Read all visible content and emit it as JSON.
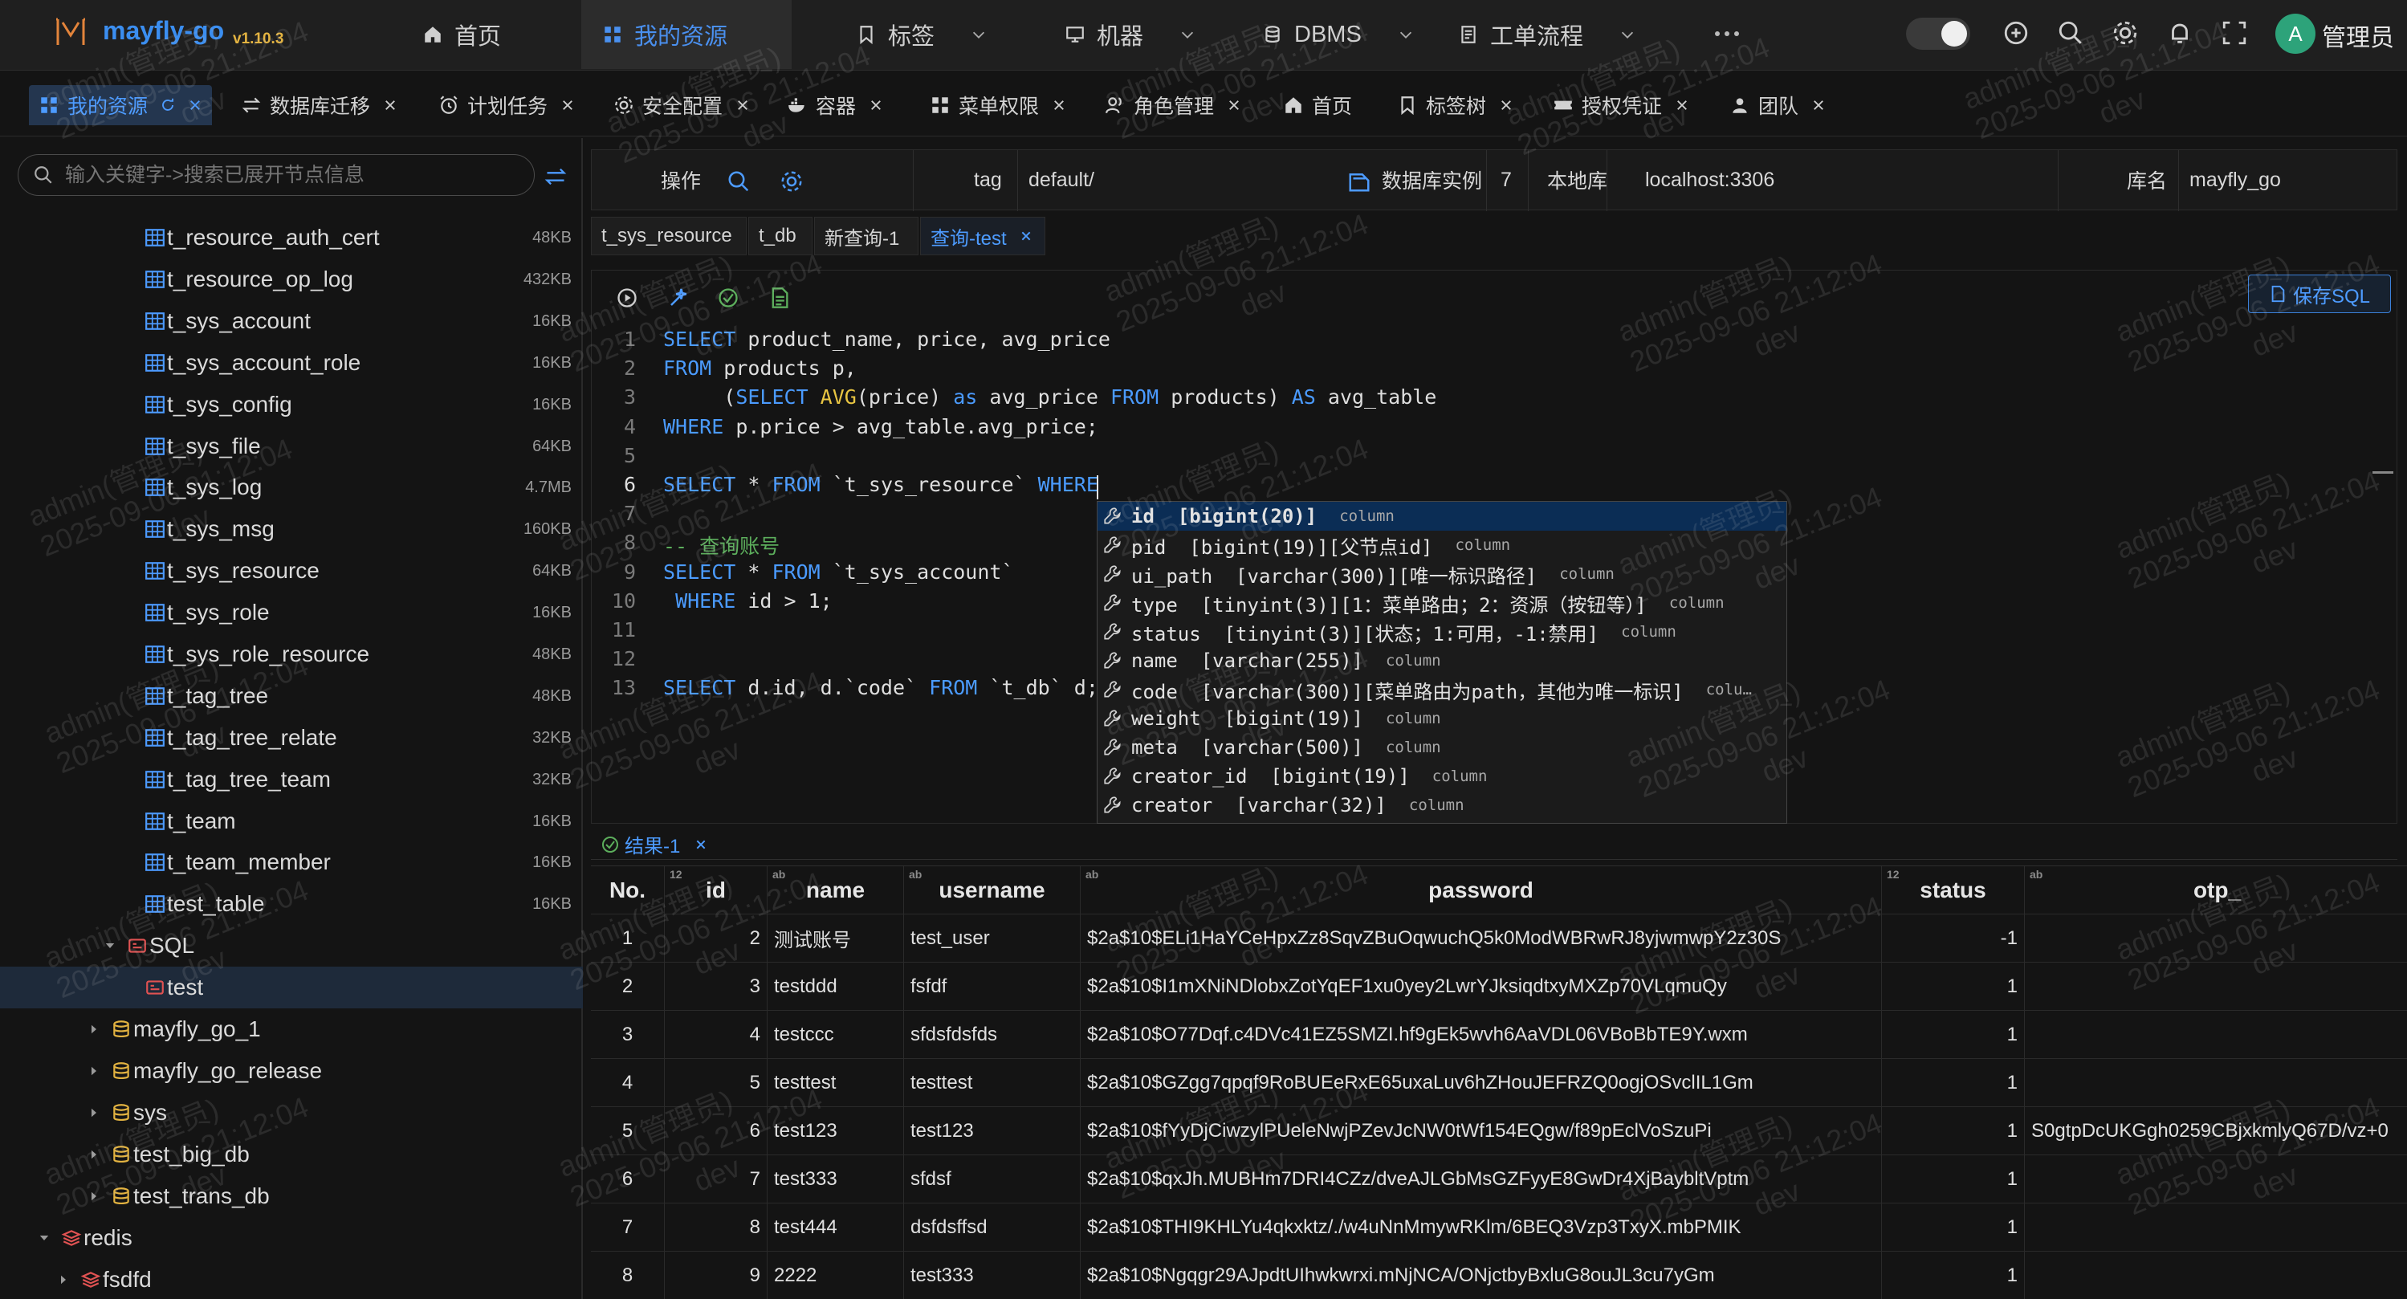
{
  "app": {
    "name": "mayfly-go",
    "version": "v1.10.3"
  },
  "nav": [
    {
      "label": "首页",
      "icon": "home-icon"
    },
    {
      "label": "我的资源",
      "icon": "grid-icon",
      "active": true
    },
    {
      "label": "标签",
      "icon": "bookmark-icon"
    },
    {
      "label": "机器",
      "icon": "monitor-icon"
    },
    {
      "label": "DBMS",
      "icon": "database-icon"
    },
    {
      "label": "工单流程",
      "icon": "workflow-icon"
    }
  ],
  "user": {
    "avatar_letter": "A",
    "name": "管理员"
  },
  "tabs": [
    {
      "label": "我的资源",
      "icon": "grid-icon",
      "active": true
    },
    {
      "label": "数据库迁移",
      "icon": "transfer-icon"
    },
    {
      "label": "计划任务",
      "icon": "alarm-icon"
    },
    {
      "label": "安全配置",
      "icon": "gear-icon"
    },
    {
      "label": "容器",
      "icon": "docker-icon"
    },
    {
      "label": "菜单权限",
      "icon": "grid-icon"
    },
    {
      "label": "角色管理",
      "icon": "users-icon"
    },
    {
      "label": "首页",
      "icon": "home-icon",
      "closable": false
    },
    {
      "label": "标签树",
      "icon": "bookmark-icon"
    },
    {
      "label": "授权凭证",
      "icon": "ticket-icon"
    },
    {
      "label": "团队",
      "icon": "user-icon"
    }
  ],
  "sidebar": {
    "search_placeholder": "输入关键字->搜索已展开节点信息",
    "tables": [
      {
        "name": "t_resource_auth_cert",
        "size": "48KB"
      },
      {
        "name": "t_resource_op_log",
        "size": "432KB"
      },
      {
        "name": "t_sys_account",
        "size": "16KB"
      },
      {
        "name": "t_sys_account_role",
        "size": "16KB"
      },
      {
        "name": "t_sys_config",
        "size": "16KB"
      },
      {
        "name": "t_sys_file",
        "size": "64KB"
      },
      {
        "name": "t_sys_log",
        "size": "4.7MB"
      },
      {
        "name": "t_sys_msg",
        "size": "160KB"
      },
      {
        "name": "t_sys_resource",
        "size": "64KB"
      },
      {
        "name": "t_sys_role",
        "size": "16KB"
      },
      {
        "name": "t_sys_role_resource",
        "size": "48KB"
      },
      {
        "name": "t_tag_tree",
        "size": "48KB"
      },
      {
        "name": "t_tag_tree_relate",
        "size": "32KB"
      },
      {
        "name": "t_tag_tree_team",
        "size": "32KB"
      },
      {
        "name": "t_team",
        "size": "16KB"
      },
      {
        "name": "t_team_member",
        "size": "16KB"
      },
      {
        "name": "test_table",
        "size": "16KB"
      }
    ],
    "sql_folder": "SQL",
    "sql_items": [
      "test"
    ],
    "databases": [
      "mayfly_go_1",
      "mayfly_go_release",
      "sys",
      "test_big_db",
      "test_trans_db"
    ],
    "redis": {
      "label": "redis",
      "children": [
        "fsdfd"
      ]
    }
  },
  "toolbar": {
    "ops_label": "操作",
    "tag_label": "tag",
    "tag_value": "default/",
    "instance_label": "数据库实例",
    "instance_count": "7",
    "instance_name": "本地库",
    "host": "localhost:3306",
    "db_label": "库名",
    "db_name": "mayfly_go"
  },
  "query_tabs": [
    {
      "label": "t_sys_resource"
    },
    {
      "label": "t_db"
    },
    {
      "label": "新查询-1"
    },
    {
      "label": "查询-test",
      "active": true
    }
  ],
  "save_sql_label": "保存SQL",
  "code_lines": [
    {
      "n": "1",
      "tokens": [
        [
          "kw",
          "SELECT"
        ],
        [
          "tx",
          " product_name, price, avg_price"
        ]
      ]
    },
    {
      "n": "2",
      "tokens": [
        [
          "kw",
          "FROM"
        ],
        [
          "tx",
          " products p,"
        ]
      ]
    },
    {
      "n": "3",
      "tokens": [
        [
          "tx",
          "     ("
        ],
        [
          "kw",
          "SELECT "
        ],
        [
          "fn",
          "AVG"
        ],
        [
          "tx",
          "(price) "
        ],
        [
          "kw",
          "as"
        ],
        [
          "tx",
          " avg_price "
        ],
        [
          "kw",
          "FROM"
        ],
        [
          "tx",
          " products) "
        ],
        [
          "kw",
          "AS"
        ],
        [
          "tx",
          " avg_table"
        ]
      ]
    },
    {
      "n": "4",
      "tokens": [
        [
          "kw",
          "WHERE"
        ],
        [
          "tx",
          " p.price > avg_table.avg_price;"
        ]
      ]
    },
    {
      "n": "5",
      "tokens": []
    },
    {
      "n": "6",
      "tokens": [
        [
          "kw",
          "SELECT"
        ],
        [
          "tx",
          " * "
        ],
        [
          "kw",
          "FROM"
        ],
        [
          "tx",
          " `t_sys_resource` "
        ],
        [
          "kw",
          "WHERE"
        ],
        [
          "tx",
          " "
        ]
      ]
    },
    {
      "n": "7",
      "tokens": []
    },
    {
      "n": "8",
      "tokens": [
        [
          "cm",
          "-- 查询账号"
        ]
      ]
    },
    {
      "n": "9",
      "tokens": [
        [
          "kw",
          "SELECT"
        ],
        [
          "tx",
          " * "
        ],
        [
          "kw",
          "FROM"
        ],
        [
          "tx",
          " `t_sys_account`"
        ]
      ]
    },
    {
      "n": "10",
      "tokens": [
        [
          "tx",
          " "
        ],
        [
          "kw",
          "WHERE"
        ],
        [
          "tx",
          " id > 1;"
        ]
      ]
    },
    {
      "n": "11",
      "tokens": []
    },
    {
      "n": "12",
      "tokens": []
    },
    {
      "n": "13",
      "tokens": [
        [
          "kw",
          "SELECT"
        ],
        [
          "tx",
          " d.id, d.`code` "
        ],
        [
          "kw",
          "FROM"
        ],
        [
          "tx",
          " `t_db` d;"
        ]
      ]
    }
  ],
  "suggestions": [
    {
      "text": "id  [bigint(20)]",
      "kind": "column"
    },
    {
      "text": "pid  [bigint(19)][父节点id]",
      "kind": "column"
    },
    {
      "text": "ui_path  [varchar(300)][唯一标识路径]",
      "kind": "column"
    },
    {
      "text": "type  [tinyint(3)][1：菜单路由；2：资源（按钮等）]",
      "kind": "column"
    },
    {
      "text": "status  [tinyint(3)][状态；1:可用，-1:禁用]",
      "kind": "column"
    },
    {
      "text": "name  [varchar(255)]",
      "kind": "column"
    },
    {
      "text": "code  [varchar(300)][菜单路由为path，其他为唯一标识]",
      "kind": "colu…"
    },
    {
      "text": "weight  [bigint(19)]",
      "kind": "column"
    },
    {
      "text": "meta  [varchar(500)]",
      "kind": "column"
    },
    {
      "text": "creator_id  [bigint(19)]",
      "kind": "column"
    },
    {
      "text": "creator  [varchar(32)]",
      "kind": "column"
    }
  ],
  "result_tab": "结果-1",
  "grid": {
    "columns": [
      {
        "label": "No.",
        "type": ""
      },
      {
        "label": "id",
        "type": "12"
      },
      {
        "label": "name",
        "type": "ab"
      },
      {
        "label": "username",
        "type": "ab"
      },
      {
        "label": "password",
        "type": "ab"
      },
      {
        "label": "status",
        "type": "12"
      },
      {
        "label": "otp_",
        "type": "ab"
      }
    ],
    "rows": [
      [
        "1",
        "2",
        "测试账号",
        "test_user",
        "$2a$10$ELi1HaYCeHpxZz8SqvZBuOqwuchQ5k0ModWBRwRJ8yjwmwpY2z30S",
        "-1",
        ""
      ],
      [
        "2",
        "3",
        "testddd",
        "fsfdf",
        "$2a$10$I1mXNiNDlobxZotYqEF1xu0yey2LwrYJksiqdtxyMXZp70VLqmuQy",
        "1",
        ""
      ],
      [
        "3",
        "4",
        "testccc",
        "sfdsfdsfds",
        "$2a$10$O77Dqf.c4DVc41EZ5SMZI.hf9gEk5wvh6AaVDL06VBoBbTE9Y.wxm",
        "1",
        ""
      ],
      [
        "4",
        "5",
        "testtest",
        "testtest",
        "$2a$10$GZgg7qpqf9RoBUEeRxE65uxaLuv6hZHouJEFRZQ0ogjOSvclIL1Gm",
        "1",
        ""
      ],
      [
        "5",
        "6",
        "test123",
        "test123",
        "$2a$10$fYyDjCiwzylPUeleNwjPZevJcNW0tWf154EQgw/f89pEclVoSzuPi",
        "1",
        "S0gtpDcUKGgh0259CBjxkmlyQ67D/vz+0"
      ],
      [
        "6",
        "7",
        "test333",
        "sfdsf",
        "$2a$10$qxJh.MUBHm7DRI4CZz/dveAJLGbMsGZFyyE8GwDr4XjBaybltVptm",
        "1",
        ""
      ],
      [
        "7",
        "8",
        "test444",
        "dsfdsffsd",
        "$2a$10$THI9KHLYu4qkxktz/./w4uNnMmywRKlm/6BEQ3Vzp3TxyX.mbPMIK",
        "1",
        ""
      ],
      [
        "8",
        "9",
        "2222",
        "test333",
        "$2a$10$Ngqgr29AJpdtUIhwkwrxi.mNjNCA/ONjctbyBxluG8ouJL3cu7yGm",
        "1",
        ""
      ]
    ]
  },
  "watermark": {
    "line1": "admin(管理员)",
    "line2": "2025-09-06 21:12:04",
    "line3": "dev"
  }
}
